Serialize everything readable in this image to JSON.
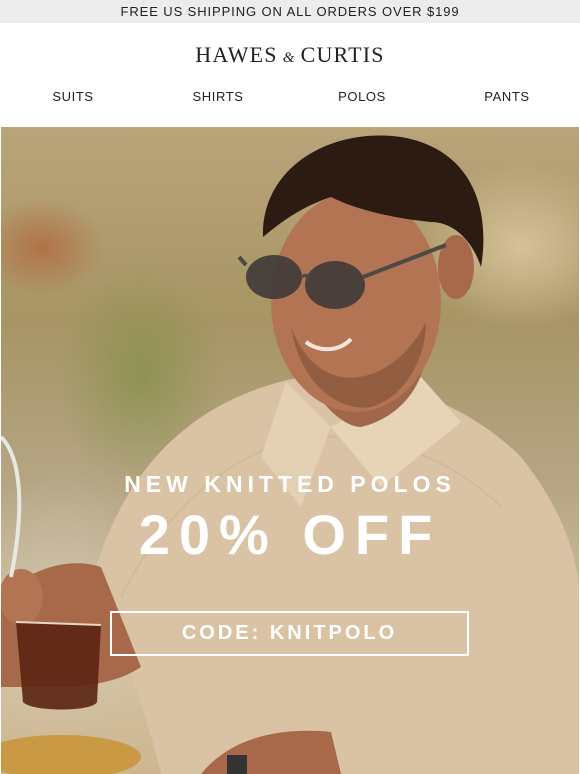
{
  "banner": {
    "text": "FREE US SHIPPING ON ALL ORDERS OVER $199"
  },
  "header": {
    "logo_left": "HAWES",
    "logo_amp": "&",
    "logo_right": "CURTIS",
    "nav": [
      {
        "label": "SUITS"
      },
      {
        "label": "SHIRTS"
      },
      {
        "label": "POLOS"
      },
      {
        "label": "PANTS"
      }
    ]
  },
  "hero": {
    "subhead": "NEW KNITTED POLOS",
    "headline": "20% OFF",
    "code": "CODE: KNITPOLO",
    "image": "man-in-knitted-polo-photo"
  },
  "colors": {
    "banner_bg": "#ececec",
    "text": "#222222",
    "hero_text": "#ffffff"
  }
}
